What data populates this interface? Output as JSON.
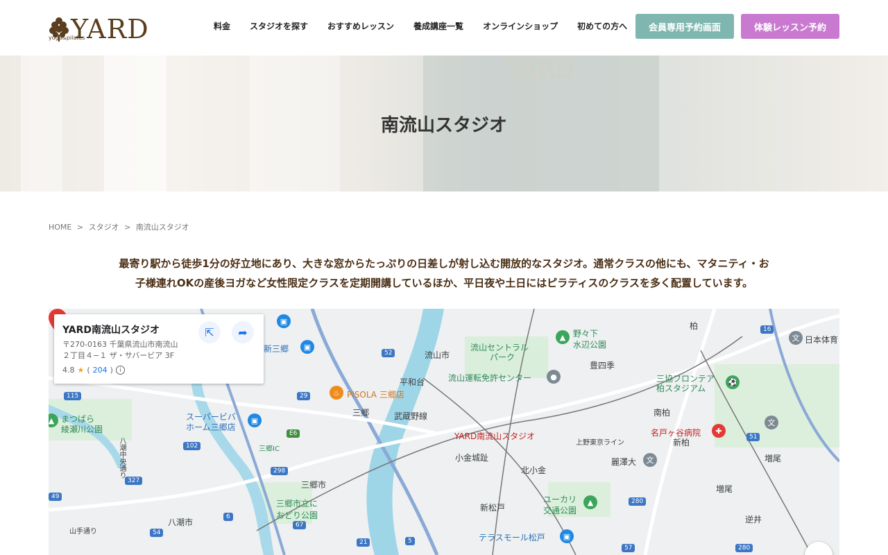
{
  "header": {
    "logo_text": "YARD",
    "logo_sub": "yoga&pilates",
    "nav": [
      "料金",
      "スタジオを探す",
      "おすすめレッスン",
      "養成講座一覧",
      "オンラインショップ",
      "初めての方へ"
    ],
    "member_button": "会員専用予約画面",
    "trial_button": "体験レッスン予約",
    "colors": {
      "member": "#7fb7b0",
      "trial": "#c97ad0",
      "brand": "#5a3e1e"
    }
  },
  "hero": {
    "title": "南流山スタジオ",
    "sign": "YARD"
  },
  "breadcrumb": [
    "HOME",
    ">",
    "スタジオ",
    ">",
    "南流山スタジオ"
  ],
  "description": {
    "line1": "最寄り駅から徒歩1分の好立地にあり、大きな窓からたっぷりの日差しが射し込む開放的なスタジオ。通常クラスの他にも、マタニティ・お",
    "line2": "子様連れOKの産後ヨガなど女性限定クラスを定期開講しているほか、平日夜や土日にはピラティスのクラスを多く配置しています。"
  },
  "map": {
    "card": {
      "name": "YARD南流山スタジオ",
      "addr1": "〒270-0163 千葉県流山市南流山",
      "addr2": "２丁目４−１ ザ・サバービア 3F",
      "rating": "4.8",
      "count": "204"
    },
    "pin_label": "YARD南流山スタジオ",
    "labels": {
      "nagareyama_city": "流山市",
      "central_park": "流山セントラル",
      "central_park2": "パーク",
      "license_center": "流山運転免許センター",
      "heiwadai": "平和台",
      "pisola": "PISOLA 三郷店",
      "misato": "三郷",
      "musashino": "武蔵野線",
      "kogane": "小金城趾",
      "kitakogane": "北小金",
      "misato_city": "三郷市",
      "misato_park1": "三郷市立に",
      "misato_park2": "おどり公園",
      "yashio": "八潮市",
      "shinmatsudo": "新松戸",
      "terrace": "テラスモール松戸",
      "yukari1": "ユーカリ",
      "yukari2": "交通公園",
      "nonoshita1": "野々下",
      "nonoshita2": "水辺公園",
      "toyoshiki": "豊四季",
      "kashiwa": "柏",
      "minamikashiwa": "南柏",
      "shinkashiwa": "新柏",
      "nagoya_hospital": "名戸ヶ谷病院",
      "reitaku": "麗澤大",
      "sankyo1": "三協フロンテア",
      "sankyo2": "柏スタジアム",
      "masuo": "増尾",
      "masuo2": "増尾",
      "sakai": "逆井",
      "shinmisato": "新三郷",
      "super_viva1": "スーパービバ",
      "super_viva2": "ホーム三郷店",
      "matsubara1": "まつばら",
      "matsubara2": "綾瀬川公園",
      "joban": "上野東京ライン",
      "misato_ic": "三郷IC",
      "nihon": "日本体育",
      "yashio_chuo": "八潮中央通り",
      "yamanote": "山手通り"
    },
    "roads": [
      "52",
      "29",
      "115",
      "102",
      "327",
      "298",
      "E6",
      "6",
      "67",
      "21",
      "5",
      "54",
      "49",
      "280",
      "57",
      "51",
      "16",
      "280"
    ]
  }
}
